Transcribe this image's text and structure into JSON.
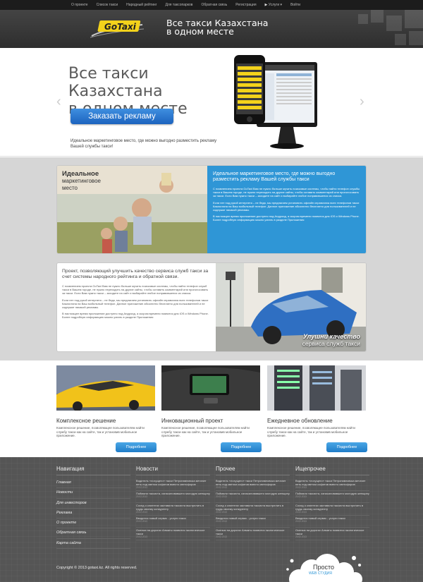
{
  "nav": {
    "items": [
      "О проекте",
      "Список такси",
      "Народный рейтинг",
      "Для таксопарков",
      "Обратная связь",
      "Регистрация",
      "Услуги",
      "Войти"
    ]
  },
  "header": {
    "logo_text": "GoTaxi",
    "slogan_line1": "Все такси Казахстана",
    "slogan_line2": "в одном месте"
  },
  "hero": {
    "title_line1": "Все такси Казахстана",
    "title_line2": "в одном месте",
    "button_label": "Заказать рекламу",
    "text": "Идеальное маркетинговое место, где можно выгодно разместить рекламу Вашей службы такси!",
    "prev_arrow": "‹",
    "next_arrow": "›"
  },
  "card1": {
    "title_line1": "Идеальное",
    "title_line2": "маркетинговое",
    "title_line3": "место",
    "heading": "Идеальное маркетинговое место, где можно выгодно разместить рекламу Вашей службы такси",
    "p1": "С появлением проекта GoTaxi Вам не нужно больше мучить поисковые системы, чтобы найти телефон службы такси в Вашем городе, не нужно переходить на другие сайты, чтобы оставить комментарий или проголосовать за такси. Если Вам нужно такси – заходите на сайт и выбирайте любое понравившееся из списка.",
    "p2": "Если нет под рукой интернета – не беда, мы предлагаем установить офлайн справочник всех телефонов такси Казахстана на Ваш мобильный телефон. Данное приложение абсолютно бесплатно для пользователей и не содержит никакой рекламы.",
    "p3": "В настоящее время приложение доступно под Андроид, а скором времени появится для iOS и Windows Phone. Более подробную информацию можно узнать в разделе Приложения"
  },
  "card2": {
    "heading": "Проект, позволяющий улучшить качество сервиса служб такси за счет системы народного рейтинга и обратной связи.",
    "p1": "С появлением проекта GoTaxi Вам не нужно больше мучить поисковые системы, чтобы найти телефон служб такси в Вашем городе, не нужно переходить на другие сайты, чтобы оставить комментарий или проголосовать за такси. Если Вам нужно такси – заходите на сайт и выбирайте любое понравившееся из списка.",
    "p2": "Если нет под рукой интернета – не беда, мы предлагаем установить офлайн справочник всех телефонов такси Казахстана на Ваш мобильный телефон. Данное приложение абсолютно бесплатно для пользователей и не содержит никакой рекламы.",
    "p3": "В настоящее время приложение доступно под Андроид, а скором времени появится для iOS и Windows Phone. Более подробную информацию можно узнать в разделе Приложения",
    "caption_line1": "Улушни качество",
    "caption_line2": "сервиса служб такси"
  },
  "features": [
    {
      "title": "Комплексное решение",
      "text": "Комплексное решение, позволяющее пользователям найти службу такси как на сайте, так и установив мобильное приложение.",
      "button": "Подробнее"
    },
    {
      "title": "Инновационный проект",
      "text": "Комплексное решение, позволяющее пользователям найти службу такси как на сайте, так и установив мобильное приложение.",
      "button": "Подробнее"
    },
    {
      "title": "Ежедневное обновление",
      "text": "Комплексное решение, позволяющее пользователям найти службу такси как на сайте, так и установив мобильное приложение.",
      "button": "Подробнее"
    }
  ],
  "footer": {
    "nav_title": "Навигация",
    "nav_items": [
      "Главная",
      "Новости",
      "Для инвесторов",
      "Реклама",
      "О проекте",
      "Обратная связь",
      "Карта сайта"
    ],
    "news_title": "Новости",
    "other_title": "Прочее",
    "more_title": "Ищепрочее",
    "news_items": [
      {
        "t": "Водитель «лохущего» такси Петропавловска мечтает петь под светом софитов вместо светофоров",
        "d": "20.02.2013"
      },
      {
        "t": "Поймали таксиста, изнасиловавшего молодую женщину",
        "d": "20.02.2013"
      },
      {
        "t": "Сосед о клиентах заставила таксиста выстрелить в грудь своему конкуренту",
        "d": "20.02.2013"
      },
      {
        "t": "Вводится новый сервис - услуги такси",
        "d": "20.02.2013"
      },
      {
        "t": "Осенью на дорогах Алматы появится экологическое такси",
        "d": "20.02.2013"
      }
    ],
    "copyright": "Copyright © 2013 gotaxi.kz. All rights reserved.",
    "studio_line1": "Просто",
    "studio_line2": "WEB СТУДИЯ"
  },
  "colors": {
    "accent_blue": "#2f96d6",
    "logo_yellow": "#f3d21b",
    "footer_bg": "#555555"
  }
}
